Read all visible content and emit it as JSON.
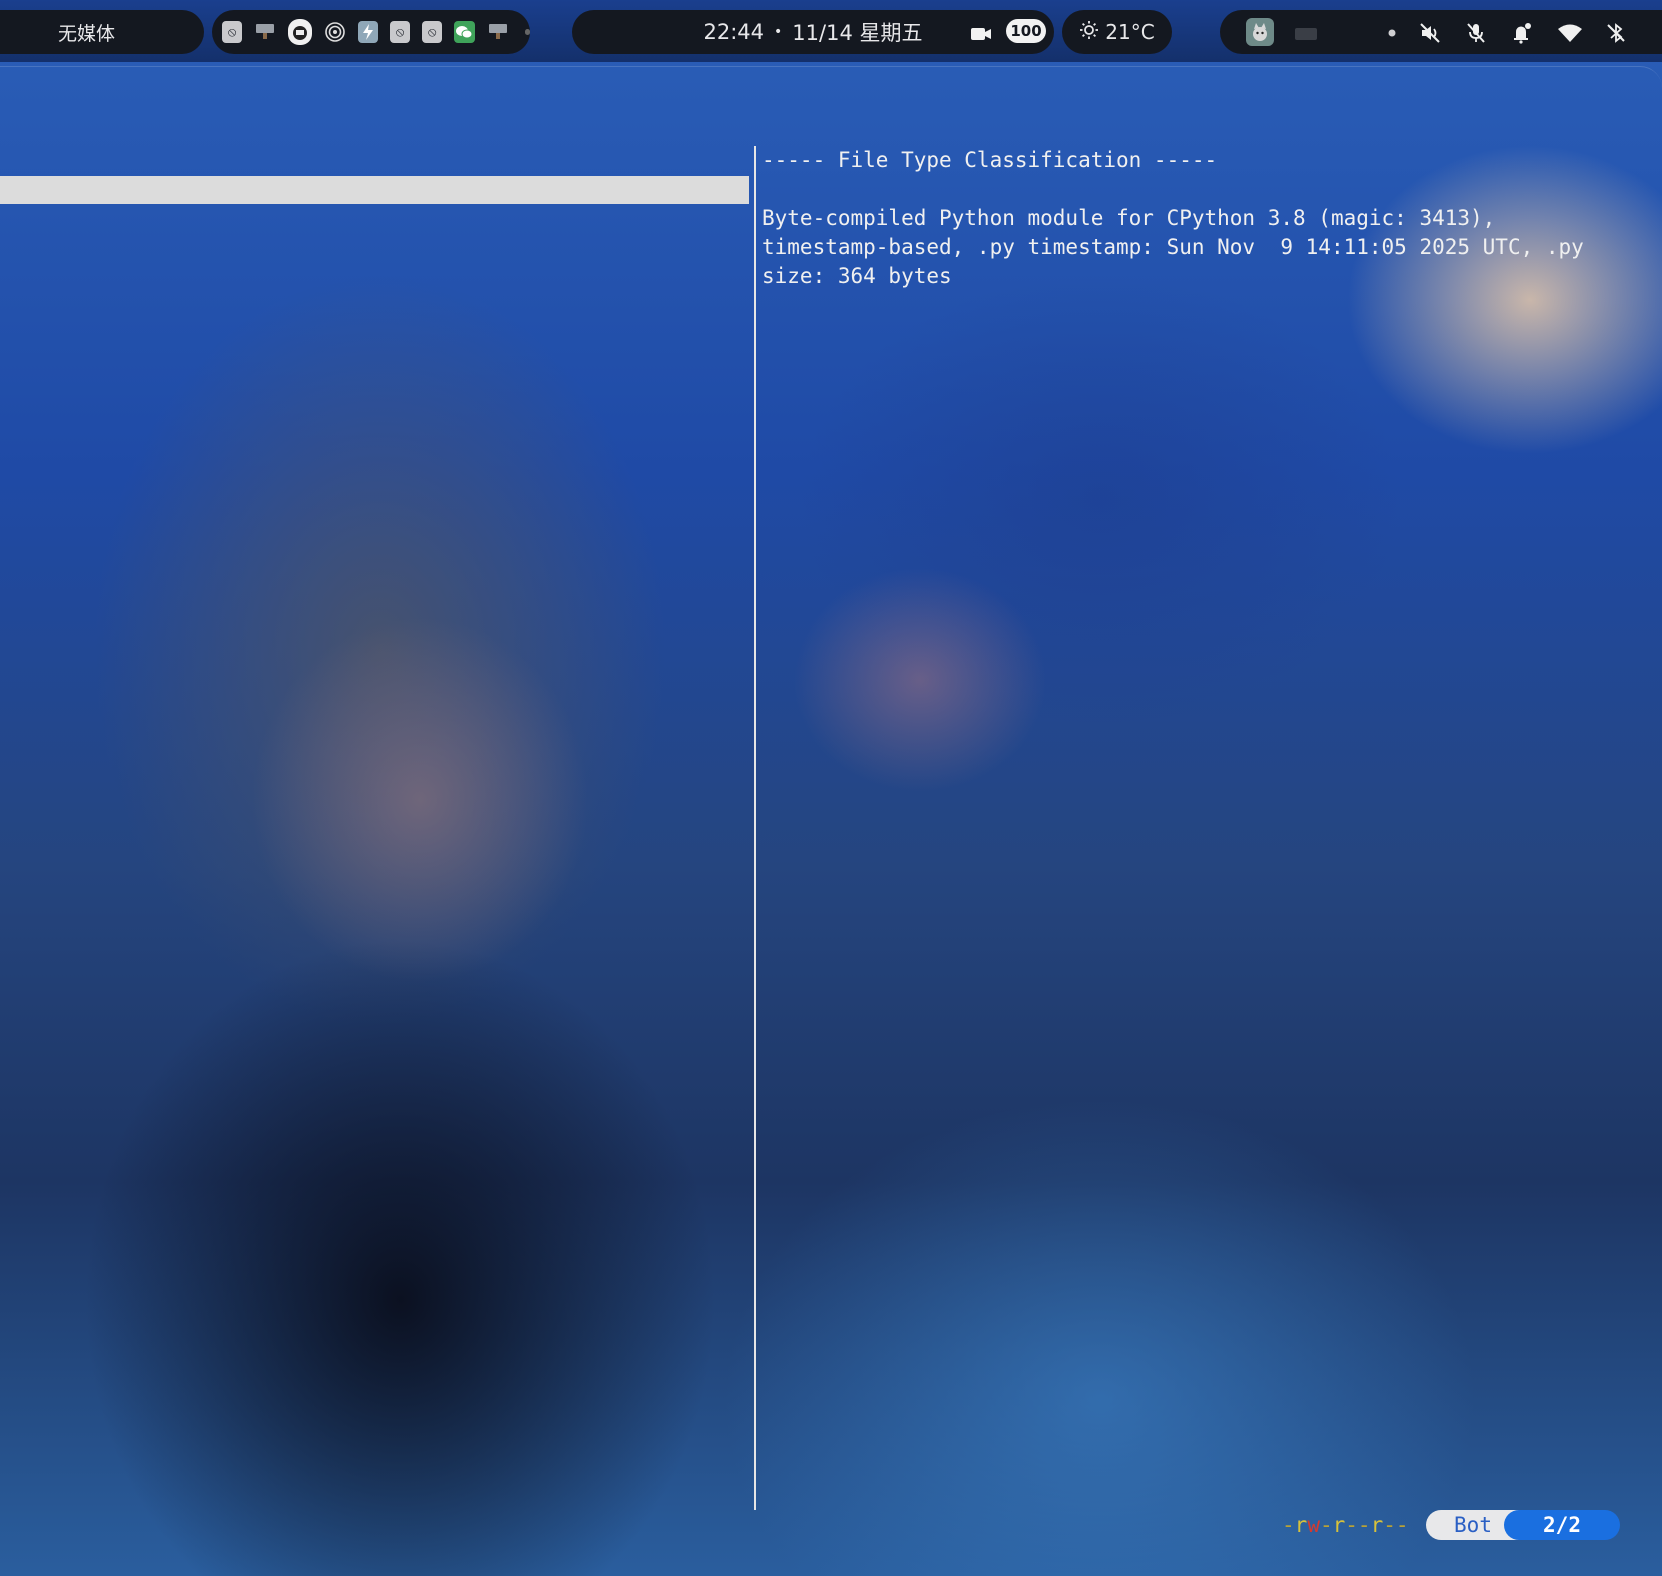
{
  "topbar": {
    "media_label": "无媒体",
    "clock": {
      "time": "22:44",
      "separator": "•",
      "date": "11/14 星期五"
    },
    "battery": "100",
    "weather": {
      "temperature": "21°C"
    },
    "tray_icons": [
      "blocked-app-icon",
      "display-icon",
      "cat-app-icon",
      "target-icon",
      "power-icon",
      "blocked-app-icon",
      "blocked-app-icon",
      "wechat-icon",
      "display-icon"
    ],
    "status_icons": [
      "cat-avatar-icon",
      "keyboard-icon",
      "dot-icon",
      "speaker-muted-icon",
      "mic-muted-icon",
      "notification-bell-icon",
      "wifi-icon",
      "bluetooth-off-icon"
    ],
    "colors": {
      "bar": "#141820",
      "accent": "#1a6fe0",
      "wechat": "#3fa35a"
    }
  },
  "terminal": {
    "preview_lines": [
      "----- File Type Classification -----",
      "",
      "Byte-compiled Python module for CPython 3.8 (magic: 3413),",
      "timestamp-based, .py timestamp: Sun Nov  9 14:11:05 2025 UTC, .py",
      "size: 364 bytes"
    ],
    "statusline": {
      "perm_dash1": "-",
      "perm_r1": "r",
      "perm_w1": "w",
      "perm_dash2": "-",
      "perm_r2": "r",
      "perm_dash3": "--",
      "perm_r3": "r",
      "perm_dash4": "--",
      "scroll_label": "Bot",
      "position": "2/2"
    }
  }
}
